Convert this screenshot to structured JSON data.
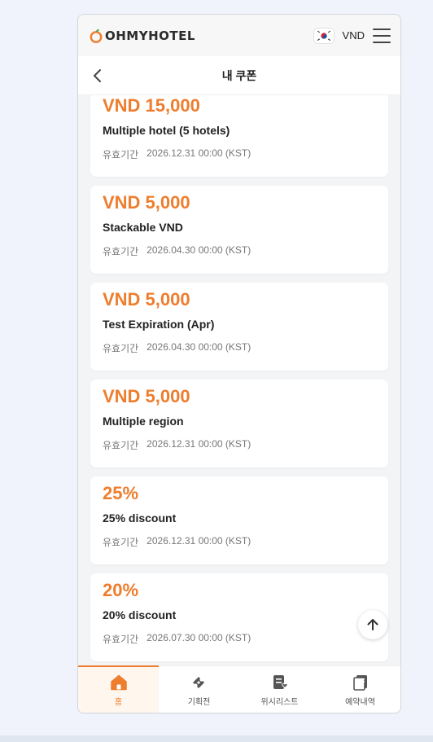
{
  "header": {
    "logo_text": "OHMYHOTEL",
    "currency": "VND"
  },
  "titlebar": {
    "title": "내 쿠폰"
  },
  "coupons": [
    {
      "amount": "VND 15,000",
      "name": "Multiple hotel (5 hotels)",
      "validity_label": "유효기간",
      "validity": "2026.12.31 00:00 (KST)"
    },
    {
      "amount": "VND 5,000",
      "name": "Stackable VND",
      "validity_label": "유효기간",
      "validity": "2026.04.30 00:00 (KST)"
    },
    {
      "amount": "VND 5,000",
      "name": "Test Expiration (Apr)",
      "validity_label": "유효기간",
      "validity": "2026.04.30 00:00 (KST)"
    },
    {
      "amount": "VND 5,000",
      "name": "Multiple region",
      "validity_label": "유효기간",
      "validity": "2026.12.31 00:00 (KST)"
    },
    {
      "amount": "25%",
      "name": "25% discount",
      "validity_label": "유효기간",
      "validity": "2026.12.31 00:00 (KST)"
    },
    {
      "amount": "20%",
      "name": "20% discount",
      "validity_label": "유효기간",
      "validity": "2026.07.30 00:00 (KST)"
    }
  ],
  "bottom_nav": [
    {
      "label": "홈",
      "icon": "home-icon",
      "active": true
    },
    {
      "label": "기획전",
      "icon": "ticket-icon",
      "active": false
    },
    {
      "label": "위시리스트",
      "icon": "wishlist-icon",
      "active": false
    },
    {
      "label": "예약내역",
      "icon": "reservations-icon",
      "active": false
    }
  ],
  "colors": {
    "accent": "#ee7d2d",
    "text": "#222222",
    "muted": "#777777"
  }
}
